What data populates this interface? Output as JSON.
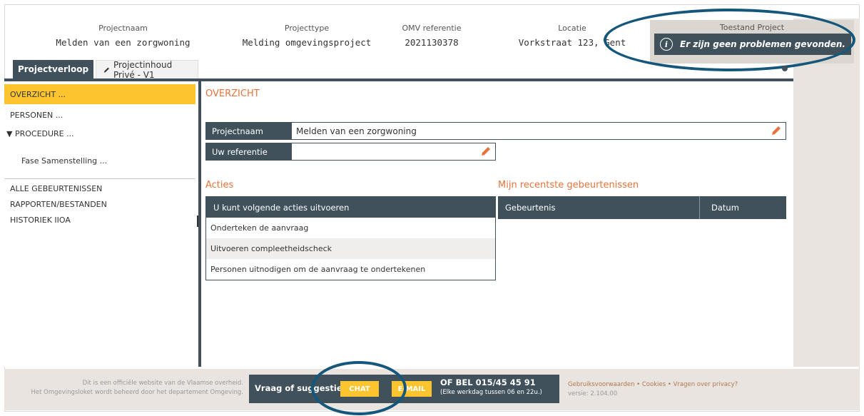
{
  "header": {
    "columns": [
      {
        "label": "Projectnaam",
        "value": "Melden van een zorgwoning"
      },
      {
        "label": "Projecttype",
        "value": "Melding omgevingsproject"
      },
      {
        "label": "OMV referentie",
        "value": "2021130378"
      },
      {
        "label": "Locatie",
        "value": "Vorkstraat 123, Gent"
      }
    ],
    "status_title": "Toestand Project",
    "status_message": "Er zijn geen problemen gevonden.",
    "status_icon": "info-icon"
  },
  "tabs": [
    {
      "label": "Projectverloop",
      "active": true
    },
    {
      "label": "Projectinhoud Privé - V1",
      "icon": "pencil-icon"
    }
  ],
  "sidebar": {
    "items": [
      {
        "label": "OVERZICHT ...",
        "active": true
      },
      {
        "label": "PERSONEN ..."
      },
      {
        "label": "▼ PROCEDURE ..."
      },
      {
        "label": "Fase Samenstelling ..."
      },
      {
        "label": "ALLE GEBEURTENISSEN"
      },
      {
        "label": "RAPPORTEN/BESTANDEN"
      },
      {
        "label": "HISTORIEK IIOA"
      }
    ]
  },
  "main": {
    "title": "OVERZICHT",
    "fields": [
      {
        "label": "Projectnaam",
        "value": "Melden van een zorgwoning"
      },
      {
        "label": "Uw referentie",
        "value": ""
      }
    ],
    "actions": {
      "title": "Acties",
      "header": "U kunt volgende acties uitvoeren",
      "rows": [
        "Onderteken de aanvraag",
        "Uitvoeren compleetheidscheck",
        "Personen uitnodigen om de aanvraag te ondertekenen"
      ]
    },
    "events": {
      "title": "Mijn recentste gebeurtenissen",
      "columns": [
        "Gebeurtenis",
        "Datum"
      ]
    }
  },
  "footer": {
    "left_line1": "Dit is een officiële website van de Vlaamse overheid.",
    "left_line2": "Het Omgevingsloket wordt beheerd door het departement Omgeving.",
    "question": "Vraag of suggestie?",
    "chat_label": "CHAT",
    "email_label": "E-MAIL",
    "call": "OF BEL 015/45 45 91",
    "hours": "(Elke werkdag tussen 06 en 22u.)",
    "links": "Gebruiksvoorwaarden • Cookies • Vragen over privacy?",
    "version": "versie: 2.104.00"
  },
  "colors": {
    "accent": "#fcc530",
    "dark": "#40515c",
    "title": "#e8733a",
    "highlight": "#15567b"
  }
}
